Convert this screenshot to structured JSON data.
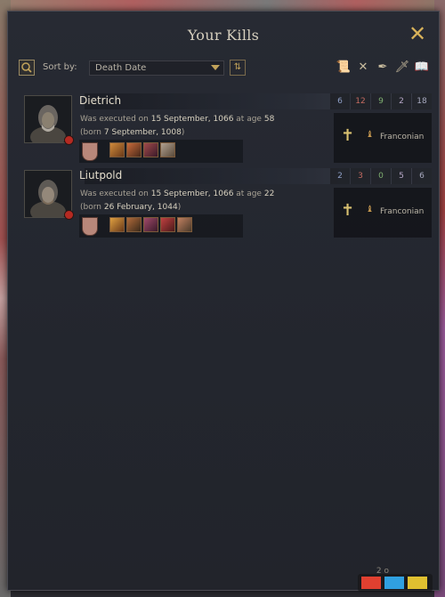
{
  "window": {
    "title": "Your Kills",
    "close_icon": "close-icon"
  },
  "toolbar": {
    "sort_label": "Sort by:",
    "sort_value": "Death Date",
    "filter_icons": [
      "scroll-icon",
      "crossed-swords-icon",
      "quill-icon",
      "sword-icon",
      "book-icon"
    ]
  },
  "kills": [
    {
      "name": "Dietrich",
      "line1_prefix": "Was executed on",
      "death_date": "15 September, 1066",
      "age_prefix": "at age",
      "age": "58",
      "born_prefix": "(born",
      "born_date": "7 September, 1008",
      "born_suffix": ")",
      "stats": [
        "6",
        "12",
        "9",
        "2",
        "18"
      ],
      "culture": "Franconian",
      "faith_icon": "cross-icon"
    },
    {
      "name": "Liutpold",
      "line1_prefix": "Was executed on",
      "death_date": "15 September, 1066",
      "age_prefix": "at age",
      "age": "22",
      "born_prefix": "(born",
      "born_date": "26 February, 1044",
      "born_suffix": ")",
      "stats": [
        "2",
        "3",
        "0",
        "5",
        "6"
      ],
      "culture": "Franconian",
      "faith_icon": "cross-icon"
    }
  ],
  "stat_colors": [
    "#8fa0c8",
    "#c46a60",
    "#7fb070",
    "#b8a8c8",
    "#a8aac0"
  ],
  "footer": {
    "page_indicator": "2 o"
  }
}
